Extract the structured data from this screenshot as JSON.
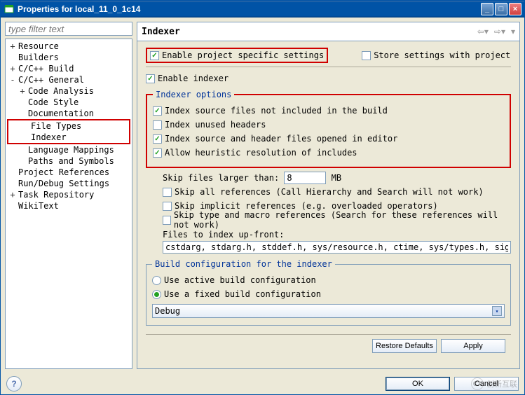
{
  "window": {
    "title": "Properties for local_11_0_1c14"
  },
  "sidebar": {
    "filter_placeholder": "type filter text",
    "tree": [
      {
        "depth": 0,
        "tw": "+",
        "label": "Resource"
      },
      {
        "depth": 0,
        "tw": "",
        "label": "Builders"
      },
      {
        "depth": 0,
        "tw": "+",
        "label": "C/C++ Build"
      },
      {
        "depth": 0,
        "tw": "-",
        "label": "C/C++ General"
      },
      {
        "depth": 1,
        "tw": "+",
        "label": "Code Analysis"
      },
      {
        "depth": 1,
        "tw": "",
        "label": "Code Style"
      },
      {
        "depth": 1,
        "tw": "",
        "label": "Documentation"
      },
      {
        "depth": 1,
        "tw": "",
        "label": "File Types",
        "hl_start": true
      },
      {
        "depth": 1,
        "tw": "",
        "label": "Indexer",
        "hl_end": true
      },
      {
        "depth": 1,
        "tw": "",
        "label": "Language Mappings"
      },
      {
        "depth": 1,
        "tw": "",
        "label": "Paths and Symbols"
      },
      {
        "depth": 0,
        "tw": "",
        "label": "Project References"
      },
      {
        "depth": 0,
        "tw": "",
        "label": "Run/Debug Settings"
      },
      {
        "depth": 0,
        "tw": "+",
        "label": "Task Repository"
      },
      {
        "depth": 0,
        "tw": "",
        "label": "WikiText"
      }
    ]
  },
  "page": {
    "title": "Indexer",
    "enable_project": {
      "checked": true,
      "label": "Enable project specific settings"
    },
    "store_settings": {
      "checked": false,
      "label": "Store settings with project"
    },
    "enable_indexer": {
      "checked": true,
      "label": "Enable indexer"
    },
    "groups": {
      "indexer_options": {
        "legend": "Indexer options",
        "index_source_not_included": {
          "checked": true,
          "label": "Index source files not included in the build"
        },
        "index_unused_headers": {
          "checked": false,
          "label": "Index unused headers"
        },
        "index_open_in_editor": {
          "checked": true,
          "label": "Index source and header files opened in editor"
        },
        "allow_heuristic": {
          "checked": true,
          "label": "Allow heuristic resolution of includes"
        },
        "skip_larger_label": "Skip files larger than:",
        "skip_larger_value": "8",
        "skip_larger_unit": "MB",
        "skip_all_refs": {
          "checked": false,
          "label": "Skip all references (Call Hierarchy and Search will not work)"
        },
        "skip_implicit_refs": {
          "checked": false,
          "label": "Skip implicit references (e.g. overloaded operators)"
        },
        "skip_type_macro": {
          "checked": false,
          "label": "Skip type and macro references (Search for these references will not work)"
        },
        "files_upfront_label": "Files to index up-front:",
        "files_upfront_value": "cstdarg, stdarg.h, stddef.h, sys/resource.h, ctime, sys/types.h, signal.h, cstdio"
      },
      "build_config": {
        "legend": "Build configuration for the indexer",
        "use_active": {
          "selected": false,
          "label": "Use active build configuration"
        },
        "use_fixed": {
          "selected": true,
          "label": "Use a fixed build configuration"
        },
        "fixed_value": "Debug"
      }
    },
    "buttons": {
      "restore": "Restore Defaults",
      "apply": "Apply",
      "ok": "OK",
      "cancel": "Cancel"
    }
  },
  "watermark": {
    "text": "创新互联"
  }
}
